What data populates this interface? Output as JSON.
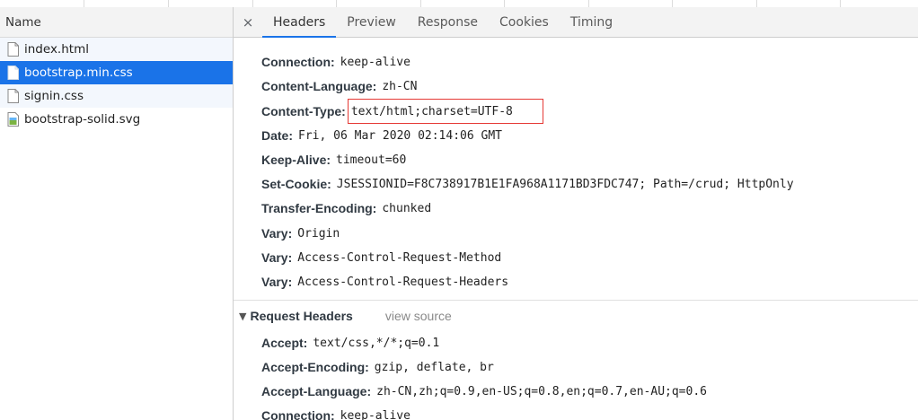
{
  "list": {
    "header": "Name",
    "files": [
      {
        "name": "index.html",
        "icon": "document-icon"
      },
      {
        "name": "bootstrap.min.css",
        "icon": "document-icon"
      },
      {
        "name": "signin.css",
        "icon": "document-icon"
      },
      {
        "name": "bootstrap-solid.svg",
        "icon": "image-icon"
      }
    ]
  },
  "tabs": {
    "close": "×",
    "items": [
      "Headers",
      "Preview",
      "Response",
      "Cookies",
      "Timing"
    ],
    "active": "Headers"
  },
  "response_headers": [
    {
      "key": "Connection:",
      "value": "keep-alive"
    },
    {
      "key": "Content-Language:",
      "value": "zh-CN"
    },
    {
      "key": "Content-Type:",
      "value": "text/html;charset=UTF-8"
    },
    {
      "key": "Date:",
      "value": "Fri, 06 Mar 2020 02:14:06 GMT"
    },
    {
      "key": "Keep-Alive:",
      "value": "timeout=60"
    },
    {
      "key": "Set-Cookie:",
      "value": "JSESSIONID=F8C738917B1E1FA968A1171BD3FDC747; Path=/crud; HttpOnly"
    },
    {
      "key": "Transfer-Encoding:",
      "value": "chunked"
    },
    {
      "key": "Vary:",
      "value": "Origin"
    },
    {
      "key": "Vary:",
      "value": "Access-Control-Request-Method"
    },
    {
      "key": "Vary:",
      "value": "Access-Control-Request-Headers"
    }
  ],
  "request_section": {
    "title": "Request Headers",
    "view_source": "view source",
    "toggle_icon": "triangle-down-icon"
  },
  "request_headers": [
    {
      "key": "Accept:",
      "value": "text/css,*/*;q=0.1"
    },
    {
      "key": "Accept-Encoding:",
      "value": "gzip, deflate, br"
    },
    {
      "key": "Accept-Language:",
      "value": "zh-CN,zh;q=0.9,en-US;q=0.8,en;q=0.7,en-AU;q=0.6"
    },
    {
      "key": "Connection:",
      "value": "keep-alive"
    }
  ],
  "colors": {
    "selected_row": "#1a73e8",
    "highlight_box": "#e53935",
    "active_tab_underline": "#1a73e8"
  }
}
